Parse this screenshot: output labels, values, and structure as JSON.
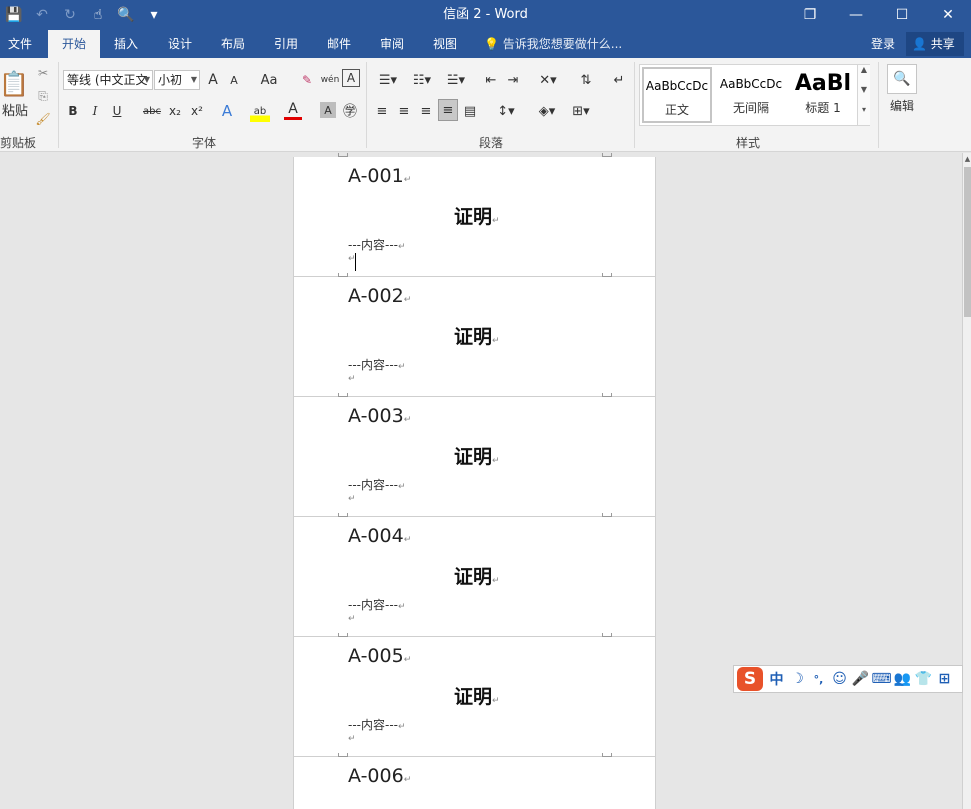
{
  "window": {
    "title": "信函 2 - Word",
    "controls": {
      "restore": "❐",
      "minimize": "—",
      "maximize": "☐",
      "close": "✕"
    }
  },
  "qat": {
    "save": "💾",
    "undo": "↶",
    "redo": "↻",
    "touch": "☝",
    "preview": "🔍",
    "more": "▾"
  },
  "tabs": [
    {
      "label": "文件"
    },
    {
      "label": "开始",
      "active": true
    },
    {
      "label": "插入"
    },
    {
      "label": "设计"
    },
    {
      "label": "布局"
    },
    {
      "label": "引用"
    },
    {
      "label": "邮件"
    },
    {
      "label": "审阅"
    },
    {
      "label": "视图"
    }
  ],
  "tell_me": {
    "icon": "💡",
    "placeholder": "告诉我您想要做什么..."
  },
  "account": {
    "login": "登录",
    "share": "共享",
    "share_icon": "👤"
  },
  "ribbon": {
    "clipboard": {
      "label": "剪贴板",
      "paste": "粘贴",
      "cut": "✂",
      "copy": "⎘",
      "painter": "🖌"
    },
    "font": {
      "label": "字体",
      "font_name": "等线 (中文正文",
      "font_size": "小初",
      "grow": "A",
      "shrink": "A",
      "case": "Aa",
      "clear": "✎",
      "phonetic": "wén",
      "border": "A",
      "bold": "B",
      "italic": "I",
      "underline": "U",
      "strike": "abc",
      "sub": "x₂",
      "sup": "x²",
      "effects": "A",
      "highlight": "ab",
      "color": "A",
      "shading": "A",
      "enclose": "㊫"
    },
    "paragraph": {
      "label": "段落"
    },
    "styles": {
      "label": "样式",
      "items": [
        {
          "sample": "AaBbCcDc",
          "name": "正文"
        },
        {
          "sample": "AaBbCcDc",
          "name": "无间隔"
        },
        {
          "sample": "AaBl",
          "name": "标题 1"
        }
      ]
    },
    "editing": {
      "label": "编辑",
      "icon": "🔍"
    }
  },
  "document": {
    "pages": [
      {
        "code": "A-001",
        "title": "证明",
        "content": "---内容---"
      },
      {
        "code": "A-002",
        "title": "证明",
        "content": "---内容---"
      },
      {
        "code": "A-003",
        "title": "证明",
        "content": "---内容---"
      },
      {
        "code": "A-004",
        "title": "证明",
        "content": "---内容---"
      },
      {
        "code": "A-005",
        "title": "证明",
        "content": "---内容---"
      },
      {
        "code": "A-006",
        "title": "",
        "content": ""
      }
    ],
    "para_mark": "↵"
  },
  "ime": {
    "logo": "S",
    "mode": "中",
    "items": [
      "☽",
      "°,",
      "☺",
      "🎤",
      "⌨",
      "👥",
      "👕",
      "⊞"
    ]
  }
}
